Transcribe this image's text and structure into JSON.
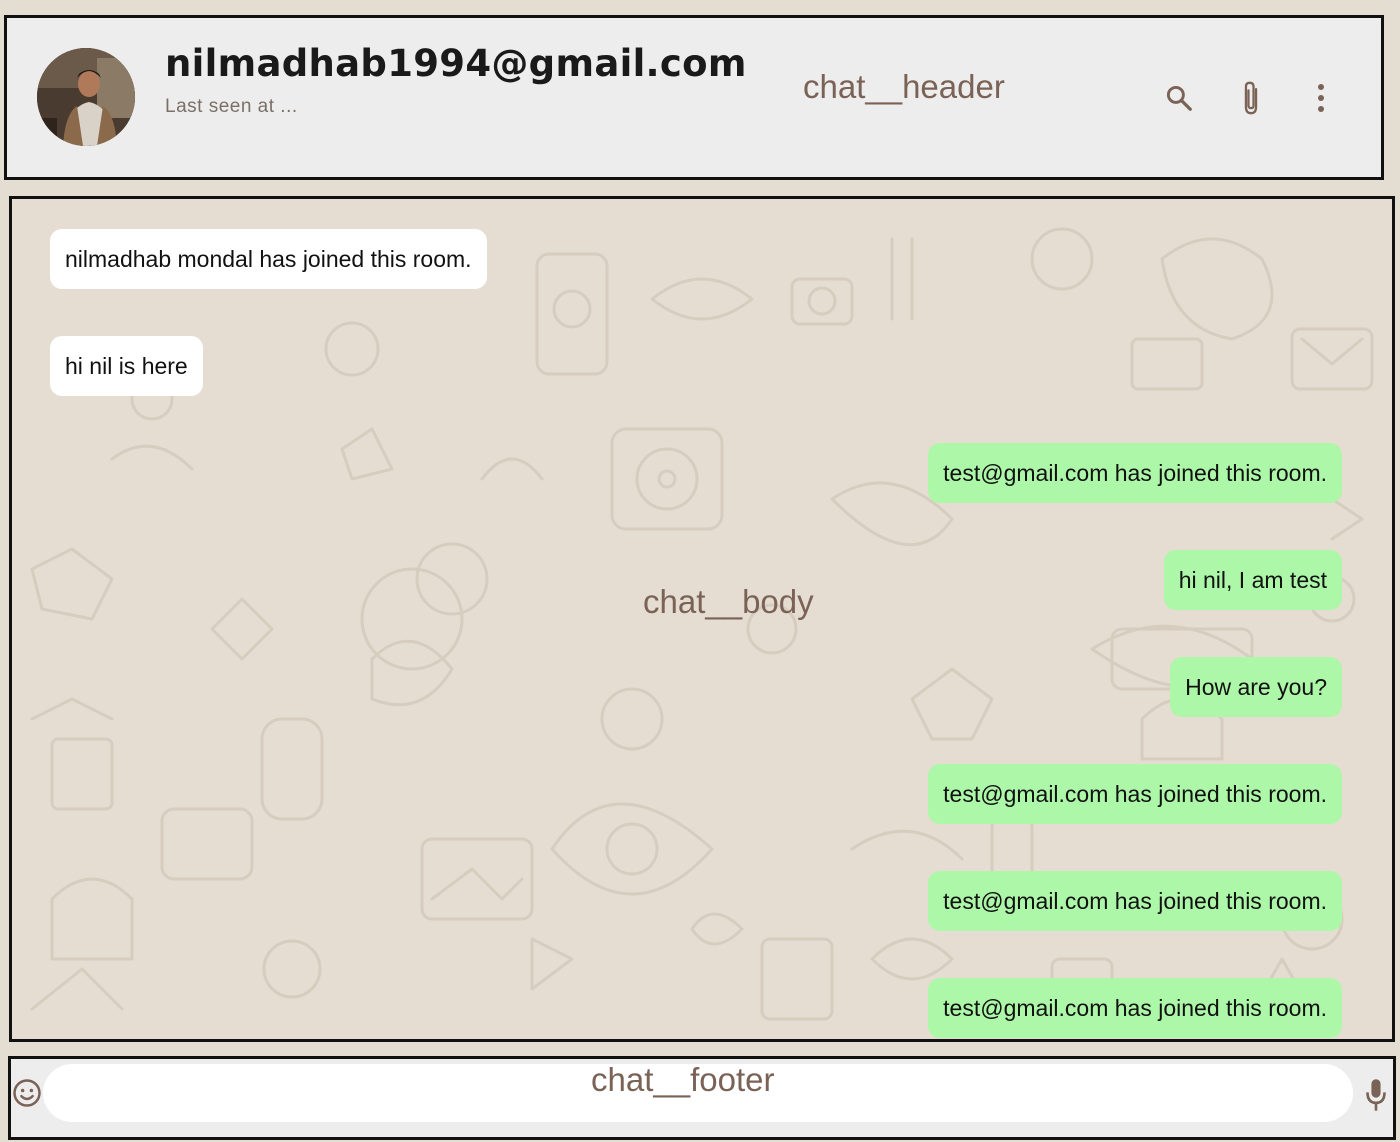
{
  "header": {
    "title": "nilmadhab1994@gmail.com",
    "subtitle": "Last seen at ...",
    "label": "chat__header",
    "icons": [
      "search-icon",
      "attach-icon",
      "more-vert-icon"
    ]
  },
  "body": {
    "label": "chat__body",
    "messages": [
      {
        "text": "nilmadhab mondal has joined this room.",
        "direction": "in"
      },
      {
        "text": "hi nil is here",
        "direction": "in"
      },
      {
        "text": "test@gmail.com has joined this room.",
        "direction": "out"
      },
      {
        "text": "hi nil, I am test",
        "direction": "out"
      },
      {
        "text": "How are you?",
        "direction": "out"
      },
      {
        "text": "test@gmail.com has joined this room.",
        "direction": "out"
      },
      {
        "text": "test@gmail.com has joined this room.",
        "direction": "out"
      },
      {
        "text": "test@gmail.com has joined this room.",
        "direction": "out"
      }
    ]
  },
  "footer": {
    "label": "chat__footer",
    "input_value": "",
    "icons": [
      "emoji-icon",
      "mic-icon"
    ]
  },
  "colors": {
    "incoming_bubble": "#ffffff",
    "outgoing_bubble": "#adf7a8",
    "label_text": "#7a6356",
    "header_bg": "#ededed"
  }
}
